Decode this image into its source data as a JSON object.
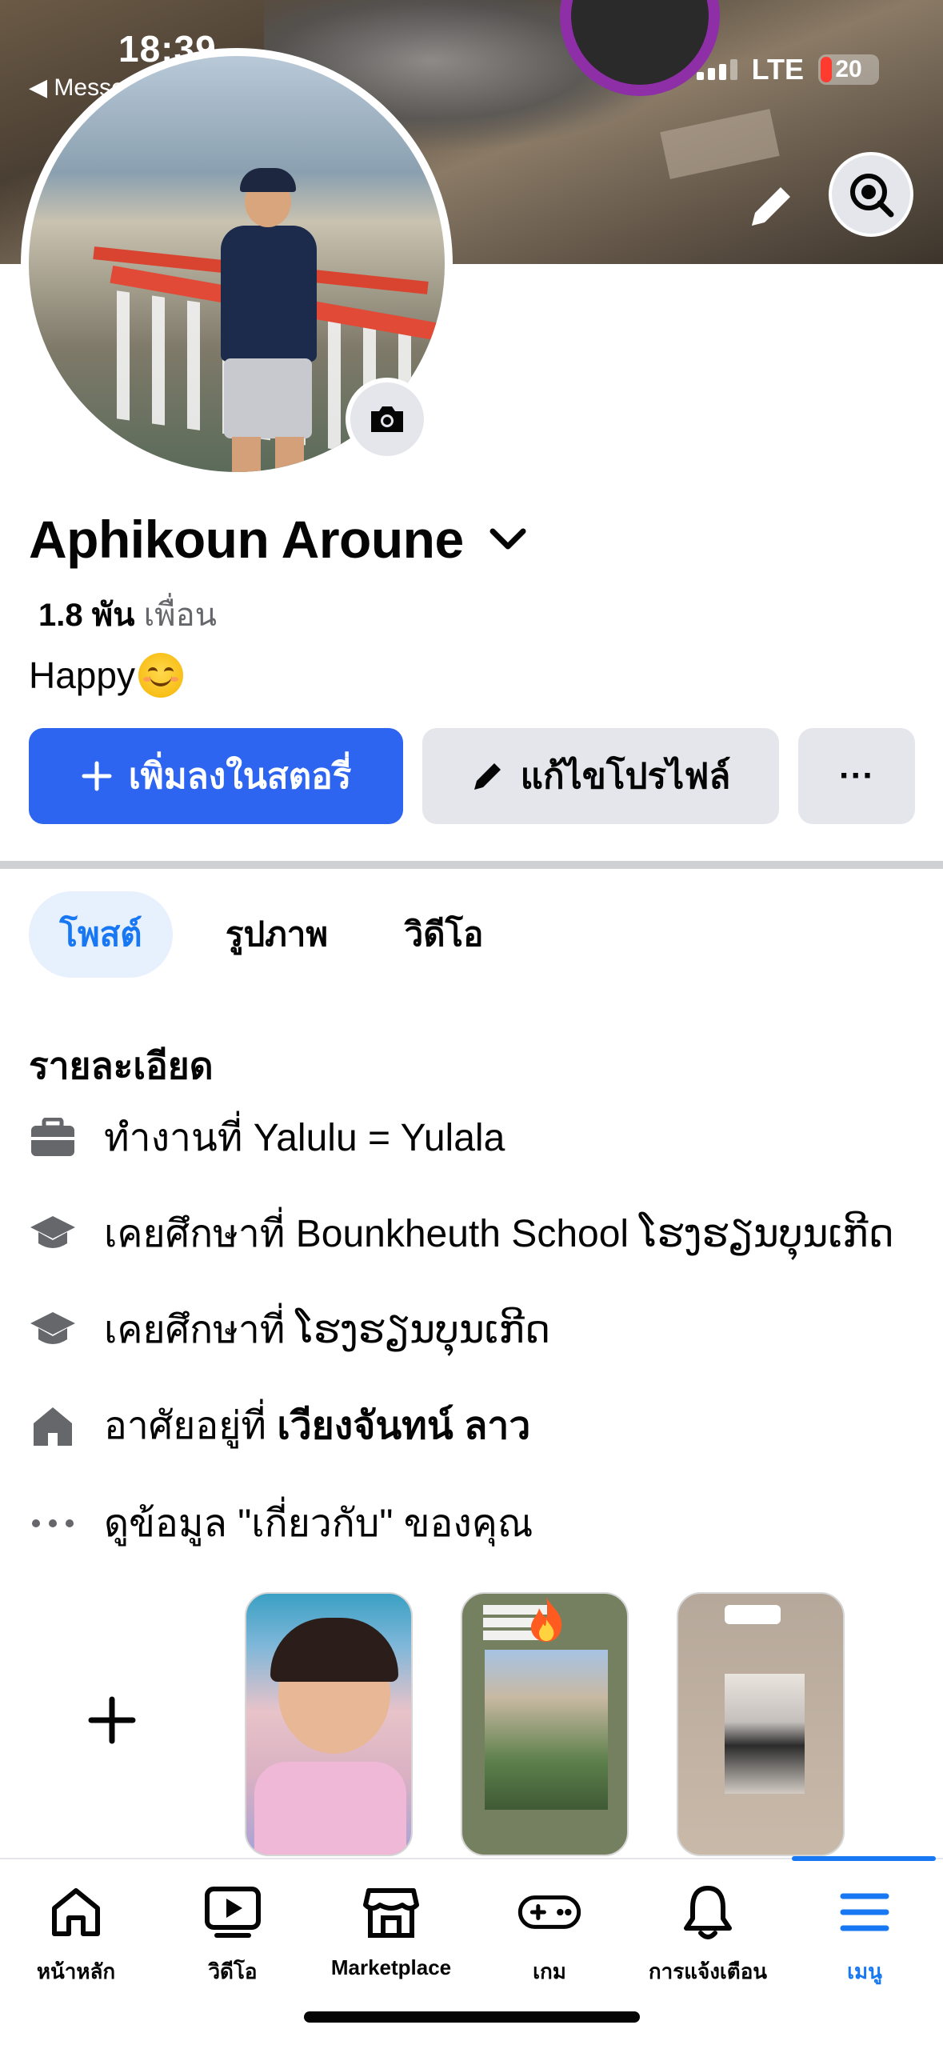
{
  "status_bar": {
    "time": "18:39",
    "back_app": "◀ Messenger",
    "network": "LTE",
    "battery": "20"
  },
  "profile": {
    "name": "Aphikoun Aroune",
    "friends_count": "1.8 พัน",
    "friends_label": "เพื่อน",
    "bio": "Happy"
  },
  "actions": {
    "add_story": "เพิ่มลงในสตอรี่",
    "edit_profile": "แก้ไขโปรไฟล์",
    "more": "···"
  },
  "tabs": [
    {
      "label": "โพสต์",
      "active": true
    },
    {
      "label": "รูปภาพ",
      "active": false
    },
    {
      "label": "วิดีโอ",
      "active": false
    }
  ],
  "details": {
    "title": "รายละเอียด",
    "work": "ทำงานที่ Yalulu = Yulala",
    "education1": "เคยศึกษาที่ Bounkheuth School ໂຮງຮຽນບຸນເກີດ",
    "education2": "เคยศึกษาที่ ໂຮງຮຽນບຸນເກີດ",
    "lives_prefix": "อาศัยอยู่ที่ ",
    "lives_place": "เวียงจันทน์ ลาว",
    "about": "ดูข้อมูล \"เกี่ยวกับ\" ของคุณ"
  },
  "bottom_nav": [
    {
      "label": "หน้าหลัก",
      "icon": "home-icon"
    },
    {
      "label": "วิดีโอ",
      "icon": "video-icon"
    },
    {
      "label": "Marketplace",
      "icon": "marketplace-icon"
    },
    {
      "label": "เกม",
      "icon": "gaming-icon"
    },
    {
      "label": "การแจ้งเตือน",
      "icon": "bell-icon"
    },
    {
      "label": "เมนู",
      "icon": "menu-icon",
      "active": true
    }
  ],
  "colors": {
    "accent": "#1877f2",
    "story_button": "#2d64f0",
    "secondary_button": "#e4e6eb",
    "text": "#050505",
    "muted": "#65676b"
  }
}
